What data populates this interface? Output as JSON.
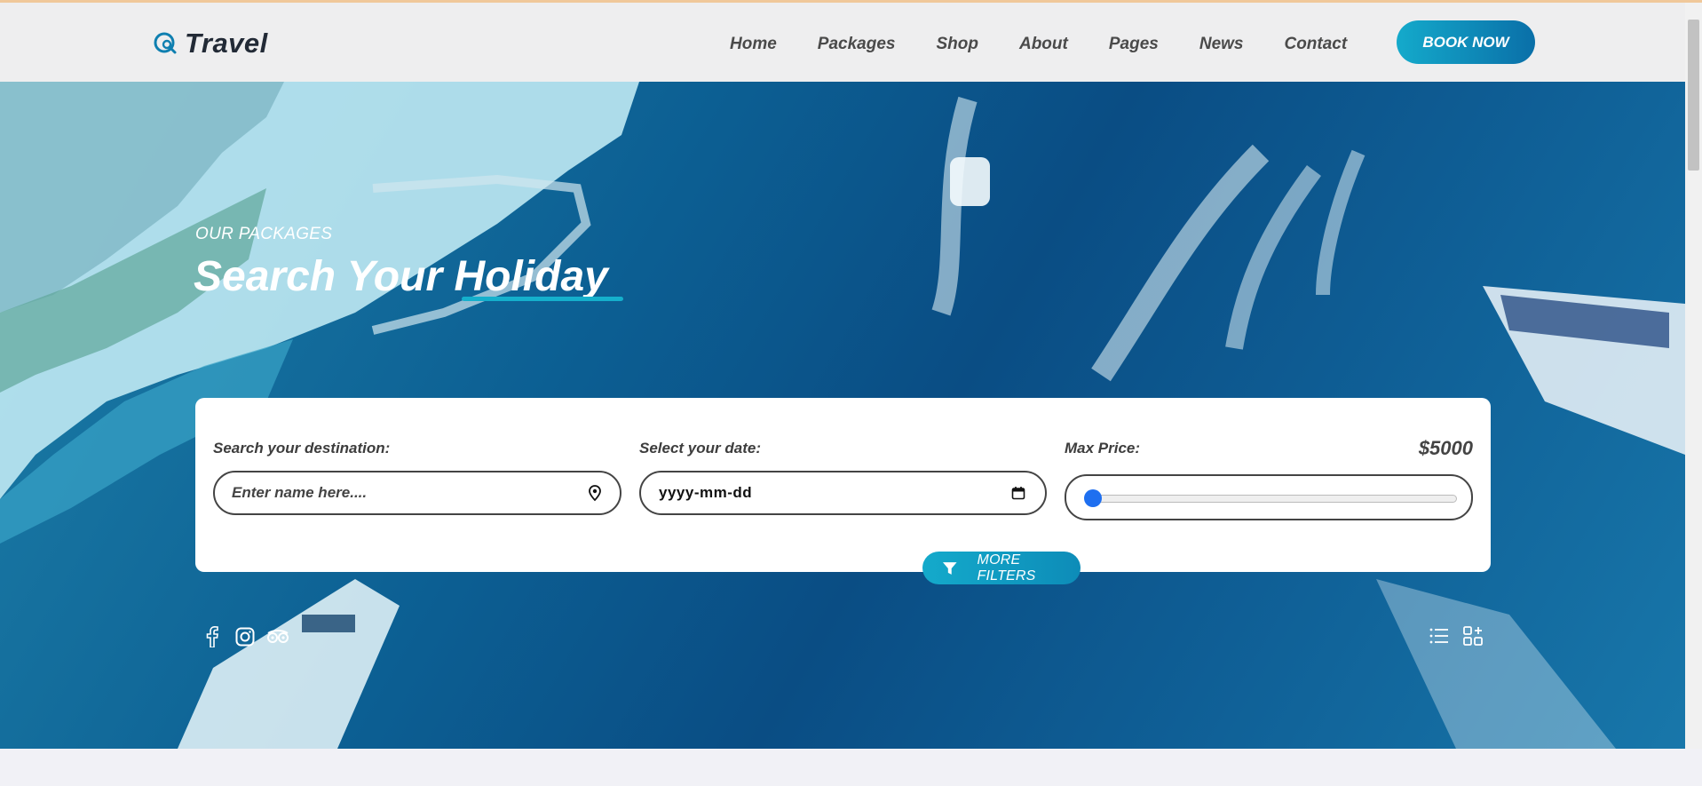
{
  "brand": {
    "name": "Travel"
  },
  "nav": {
    "items": [
      "Home",
      "Packages",
      "Shop",
      "About",
      "Pages",
      "News",
      "Contact"
    ],
    "book_label": "BOOK NOW"
  },
  "hero": {
    "kicker": "OUR PACKAGES",
    "title": "Search Your Holiday"
  },
  "search": {
    "destination_label": "Search your destination:",
    "destination_placeholder": "Enter name here....",
    "date_label": "Select your date:",
    "date_placeholder": "yyyy-mm-dd",
    "price_label": "Max Price:",
    "price_value": "$5000",
    "price_slider_fraction": 0.0
  },
  "filters": {
    "label": "MORE FILTERS"
  },
  "social": [
    "facebook-icon",
    "instagram-icon",
    "tripadvisor-icon"
  ],
  "views": [
    "list-view-icon",
    "grid-view-icon"
  ],
  "colors": {
    "accent": "#14aacb",
    "accent_dark": "#0a6fa8",
    "card": "#ffffff",
    "nav_bg": "#eeeeef"
  }
}
